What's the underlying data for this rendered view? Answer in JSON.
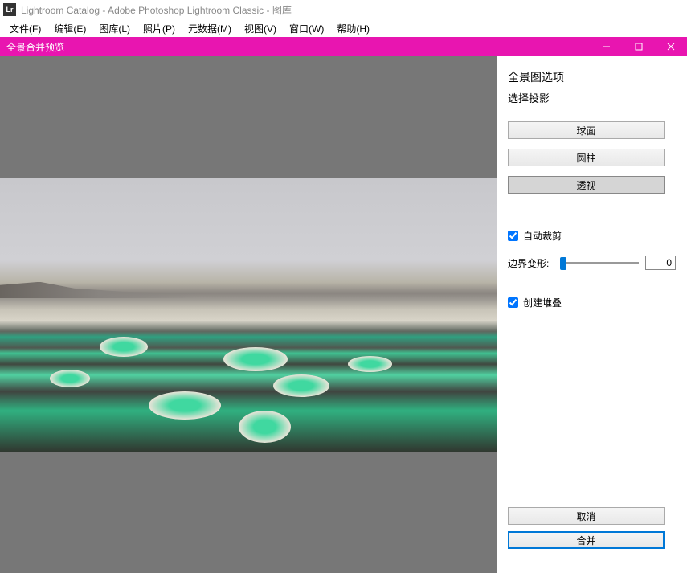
{
  "titlebar": {
    "logo": "Lr",
    "title": "Lightroom Catalog - Adobe Photoshop Lightroom Classic - 图库"
  },
  "menubar": {
    "items": [
      "文件(F)",
      "编辑(E)",
      "图库(L)",
      "照片(P)",
      "元数据(M)",
      "视图(V)",
      "窗口(W)",
      "帮助(H)"
    ]
  },
  "dialog": {
    "title": "全景合并预览",
    "options_title": "全景图选项",
    "projection_title": "选择投影",
    "projections": [
      "球面",
      "圆柱",
      "透视"
    ],
    "selected_projection_index": 2,
    "auto_crop_label": "自动裁剪",
    "auto_crop_checked": true,
    "boundary_warp_label": "边界变形:",
    "boundary_warp_value": "0",
    "create_stack_label": "创建堆叠",
    "create_stack_checked": true,
    "cancel_label": "取消",
    "merge_label": "合并"
  }
}
